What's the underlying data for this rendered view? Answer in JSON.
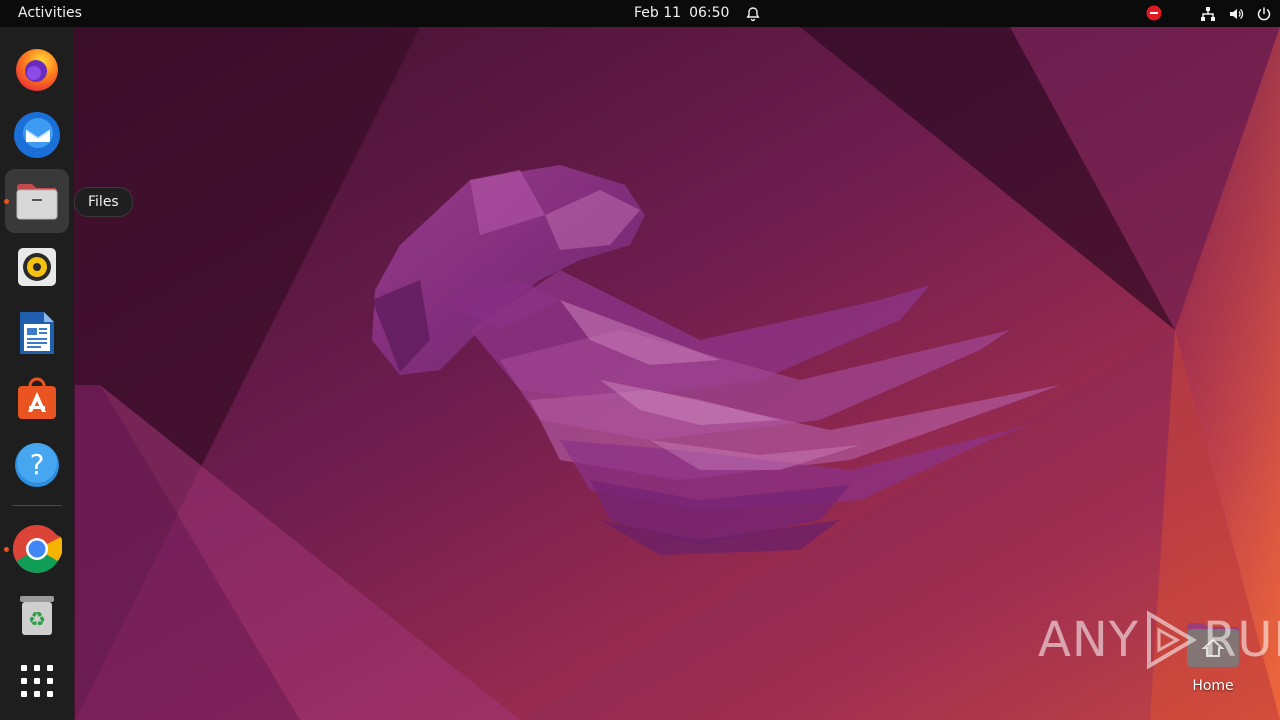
{
  "topbar": {
    "activities_label": "Activities",
    "date": "Feb 11",
    "time": "06:50"
  },
  "dock": {
    "items": [
      {
        "name": "Firefox",
        "running": false
      },
      {
        "name": "Thunderbird",
        "running": false
      },
      {
        "name": "Files",
        "running": true,
        "active": true
      },
      {
        "name": "Rhythmbox",
        "running": false
      },
      {
        "name": "LibreOffice Writer",
        "running": false
      },
      {
        "name": "Ubuntu Software",
        "running": false
      },
      {
        "name": "Help",
        "running": false
      },
      {
        "name": "Google Chrome",
        "running": true
      },
      {
        "name": "Trash",
        "running": false
      },
      {
        "name": "Show Applications",
        "running": false
      }
    ],
    "tooltip": "Files"
  },
  "desktop": {
    "home_label": "Home"
  },
  "watermark": {
    "text_left": "ANY",
    "text_right": "RUN"
  },
  "colors": {
    "accent": "#e95420",
    "topbar_bg": "#0b0b0b",
    "dock_bg": "#1e1e1e",
    "dnd_red": "#e01b24"
  },
  "icons": [
    "bell-icon",
    "do-not-disturb-icon",
    "network-icon",
    "volume-icon",
    "power-icon"
  ]
}
